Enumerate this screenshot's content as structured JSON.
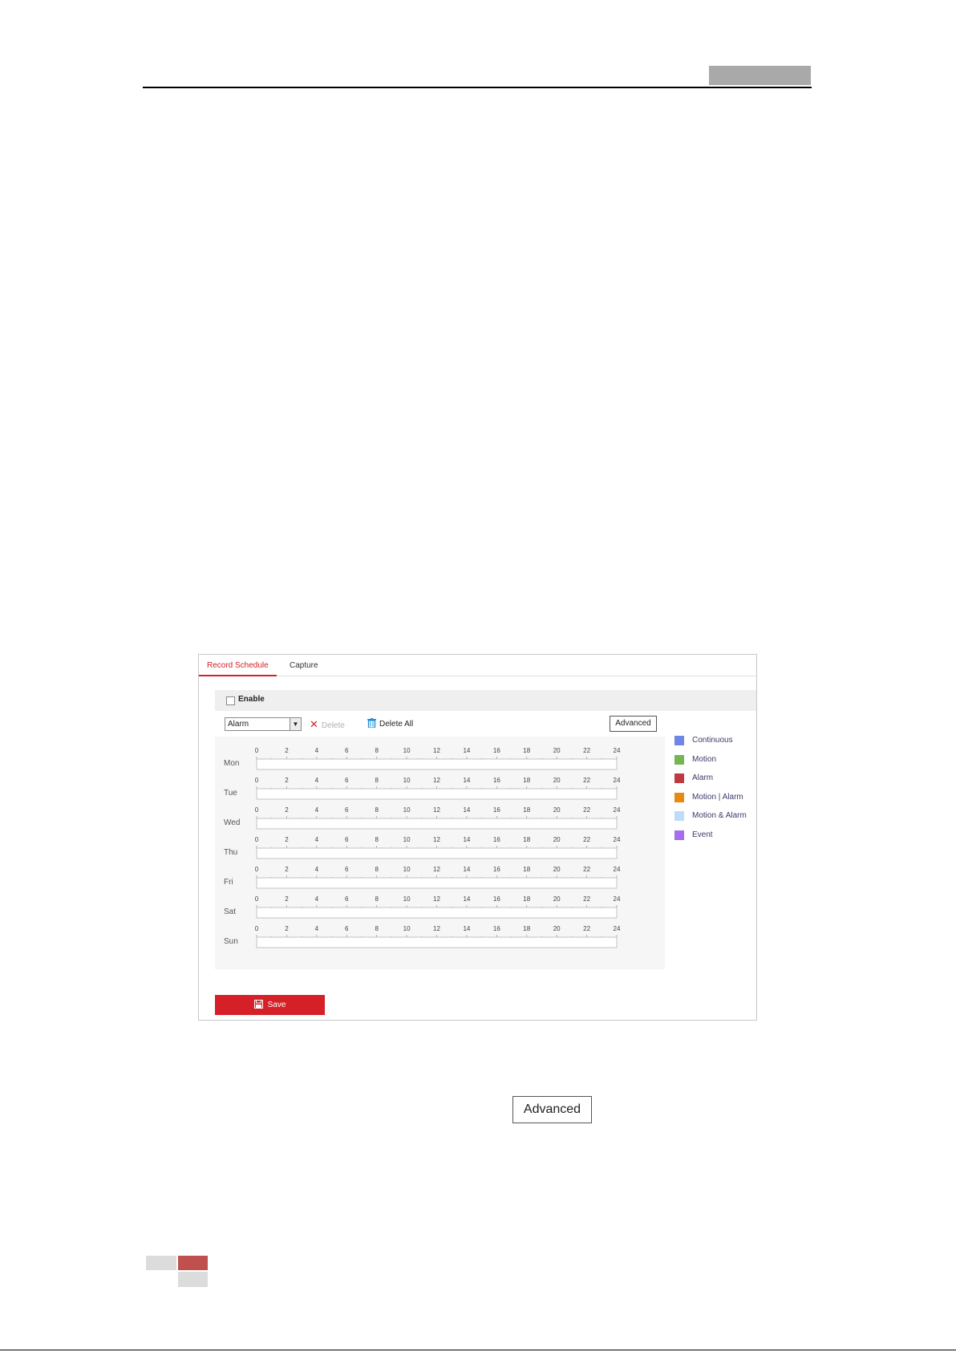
{
  "tabs": [
    {
      "label": "Record Schedule",
      "active": true
    },
    {
      "label": "Capture",
      "active": false
    }
  ],
  "enable": {
    "label": "Enable",
    "checked": false
  },
  "toolbar": {
    "record_type": "Alarm",
    "delete_label": "Delete",
    "delete_all_label": "Delete All",
    "advanced_label": "Advanced"
  },
  "schedule": {
    "days": [
      "Mon",
      "Tue",
      "Wed",
      "Thu",
      "Fri",
      "Sat",
      "Sun"
    ],
    "hour_labels": [
      "0",
      "2",
      "4",
      "6",
      "8",
      "10",
      "12",
      "14",
      "16",
      "18",
      "20",
      "22",
      "24"
    ]
  },
  "legend": [
    {
      "label": "Continuous",
      "color": "#6d86e8"
    },
    {
      "label": "Motion",
      "color": "#74b652"
    },
    {
      "label": "Alarm",
      "color": "#c0393e"
    },
    {
      "label": "Motion | Alarm",
      "color": "#e58a12"
    },
    {
      "label": "Motion & Alarm",
      "color": "#bcdcf7"
    },
    {
      "label": "Event",
      "color": "#a66df0"
    }
  ],
  "save_label": "Save",
  "figure_button_label": "Advanced",
  "colors": {
    "accent": "#d52027"
  }
}
